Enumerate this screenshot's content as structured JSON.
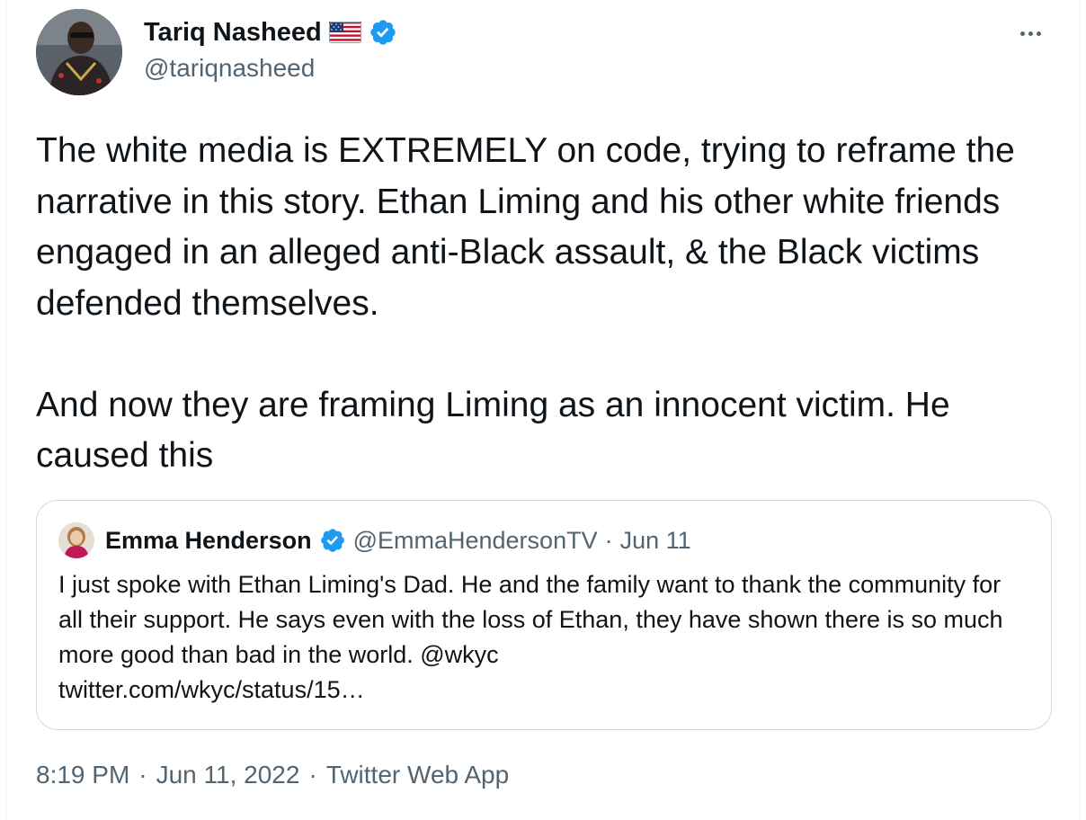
{
  "author": {
    "name": "Tariq Nasheed",
    "flag_icon": "us-flag-icon",
    "verified_icon": "verified-badge-icon",
    "handle": "@tariqnasheed"
  },
  "more_icon": "more-options-icon",
  "tweet": {
    "text": "The white media is EXTREMELY on code, trying to reframe the narrative in this story. Ethan Liming and his other white friends engaged in an alleged anti-Black assault, & the Black victims defended themselves.\n\nAnd now they are framing Liming as an innocent victim. He caused this"
  },
  "quote": {
    "name": "Emma Henderson",
    "handle": "@EmmaHendersonTV",
    "separator": "·",
    "date": "Jun 11",
    "text": "I just spoke with Ethan Liming's Dad. He and the family want to thank the community for all their support. He says even with the loss of Ethan, they have shown there is so much more good than bad in the world. @wkyc\ntwitter.com/wkyc/status/15…"
  },
  "meta": {
    "time": "8:19 PM",
    "sep1": "·",
    "date": "Jun 11, 2022",
    "sep2": "·",
    "source": "Twitter Web App"
  },
  "colors": {
    "text": "#0f1419",
    "secondary": "#536471",
    "verified": "#1d9bf0",
    "border": "#cfd9de"
  }
}
